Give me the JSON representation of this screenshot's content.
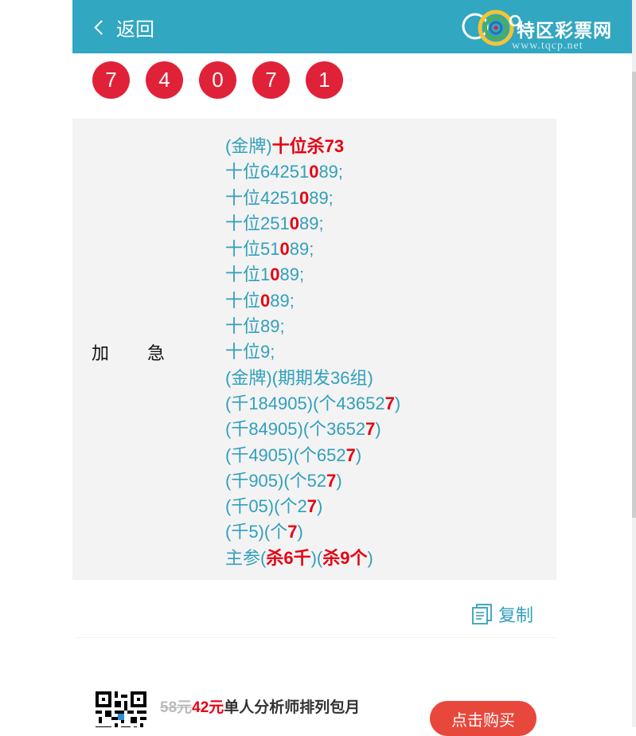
{
  "header": {
    "back_label": "返回",
    "logo_text": "特区彩票网",
    "logo_url": "www.tqcp.net",
    "bg_color": "#31a7c1"
  },
  "numbers": [
    "7",
    "4",
    "0",
    "7",
    "1"
  ],
  "panel": {
    "label": "加急",
    "lines": [
      [
        {
          "t": "(金牌)",
          "h": false
        },
        {
          "t": "十位杀73",
          "h": true
        }
      ],
      [
        {
          "t": "十位64251",
          "h": false
        },
        {
          "t": "0",
          "h": true
        },
        {
          "t": "89;",
          "h": false
        }
      ],
      [
        {
          "t": "十位4251",
          "h": false
        },
        {
          "t": "0",
          "h": true
        },
        {
          "t": "89;",
          "h": false
        }
      ],
      [
        {
          "t": "十位251",
          "h": false
        },
        {
          "t": "0",
          "h": true
        },
        {
          "t": "89;",
          "h": false
        }
      ],
      [
        {
          "t": "十位51",
          "h": false
        },
        {
          "t": "0",
          "h": true
        },
        {
          "t": "89;",
          "h": false
        }
      ],
      [
        {
          "t": "十位1",
          "h": false
        },
        {
          "t": "0",
          "h": true
        },
        {
          "t": "89;",
          "h": false
        }
      ],
      [
        {
          "t": "十位",
          "h": false
        },
        {
          "t": "0",
          "h": true
        },
        {
          "t": "89;",
          "h": false
        }
      ],
      [
        {
          "t": "十位89;",
          "h": false
        }
      ],
      [
        {
          "t": "十位9;",
          "h": false
        }
      ],
      [
        {
          "t": "(金牌)(期期发36组)",
          "h": false
        }
      ],
      [
        {
          "t": "(千184905)(个43652",
          "h": false
        },
        {
          "t": "7",
          "h": true
        },
        {
          "t": ")",
          "h": false
        }
      ],
      [
        {
          "t": "(千84905)(个3652",
          "h": false
        },
        {
          "t": "7",
          "h": true
        },
        {
          "t": ")",
          "h": false
        }
      ],
      [
        {
          "t": "(千4905)(个652",
          "h": false
        },
        {
          "t": "7",
          "h": true
        },
        {
          "t": ")",
          "h": false
        }
      ],
      [
        {
          "t": "(千905)(个52",
          "h": false
        },
        {
          "t": "7",
          "h": true
        },
        {
          "t": ")",
          "h": false
        }
      ],
      [
        {
          "t": "(千05)(个2",
          "h": false
        },
        {
          "t": "7",
          "h": true
        },
        {
          "t": ")",
          "h": false
        }
      ],
      [
        {
          "t": "(千5)(个",
          "h": false
        },
        {
          "t": "7",
          "h": true
        },
        {
          "t": ")",
          "h": false
        }
      ],
      [
        {
          "t": "主参(",
          "h": false
        },
        {
          "t": "杀6千",
          "h": true
        },
        {
          "t": ")(",
          "h": false
        },
        {
          "t": "杀9个",
          "h": true
        },
        {
          "t": ")",
          "h": false
        }
      ]
    ]
  },
  "copy_label": "复制",
  "promo": {
    "old_price": "58元",
    "new_price": "42元",
    "description": "单人分析师排列包月",
    "buy_label": "点击购买"
  },
  "colors": {
    "ball": "#e02239",
    "highlight": "#e60012",
    "text_teal": "#31a0bb"
  }
}
